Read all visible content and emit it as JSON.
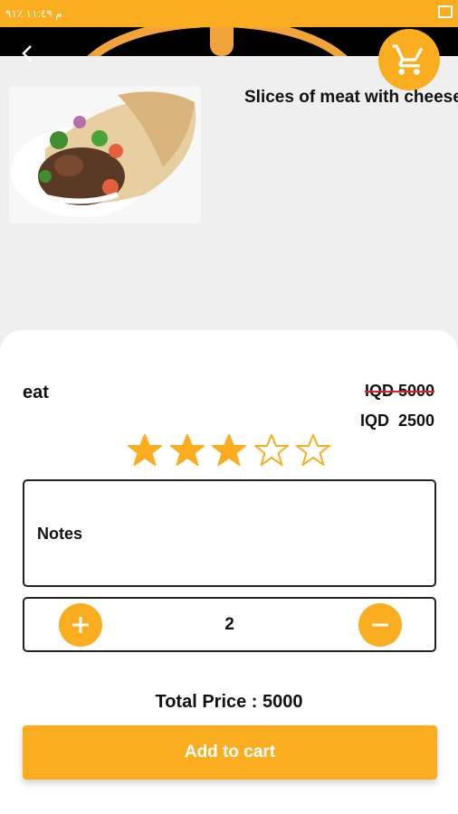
{
  "status_bar": {
    "left_text": "م ١١:٤٩  ٪٩١"
  },
  "product": {
    "description": "Slices of meat with cheese",
    "name": "eat",
    "old_price": "IQD 5000",
    "new_price": "IQD  2500",
    "rating": 3,
    "rating_max": 5
  },
  "notes": {
    "label": "Notes"
  },
  "quantity": {
    "value": "2"
  },
  "total": {
    "label": "Total Price : ",
    "value": "5000"
  },
  "actions": {
    "add_to_cart": "Add to cart"
  },
  "colors": {
    "accent": "#f9ad1f",
    "strike": "#e02020"
  },
  "icons": {
    "cart": "shopping-cart-icon",
    "back": "back-arrow-icon",
    "plus": "plus-icon",
    "minus": "minus-icon",
    "star": "star-icon"
  }
}
